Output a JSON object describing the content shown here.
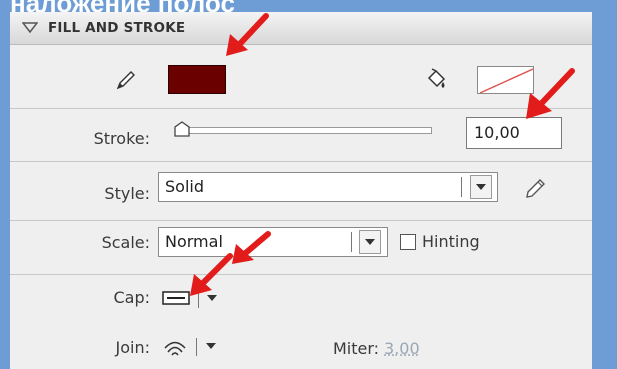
{
  "caption": "наложение полос",
  "panel": {
    "section_title": "FILL AND STROKE",
    "stroke_label": "Stroke:",
    "stroke_value": "10,00",
    "style_label": "Style:",
    "style_value": "Solid",
    "scale_label": "Scale:",
    "scale_value": "Normal",
    "hinting_label": "Hinting",
    "hinting_checked": false,
    "cap_label": "Cap:",
    "join_label": "Join:",
    "miter_label": "Miter:",
    "miter_value": "3,00"
  },
  "colors": {
    "background": "#6d9dd4",
    "stroke_color": "#6b0000",
    "annotation_arrow": "#e21b1b"
  },
  "icons": {
    "stroke_color": "pencil-icon",
    "fill_color": "paint-bucket-icon",
    "fill_swatch": "no-color-icon",
    "style_edit": "pencil-edit-icon",
    "cap": "cap-none-icon",
    "join": "join-round-icon",
    "section_toggle": "triangle-down-icon"
  }
}
